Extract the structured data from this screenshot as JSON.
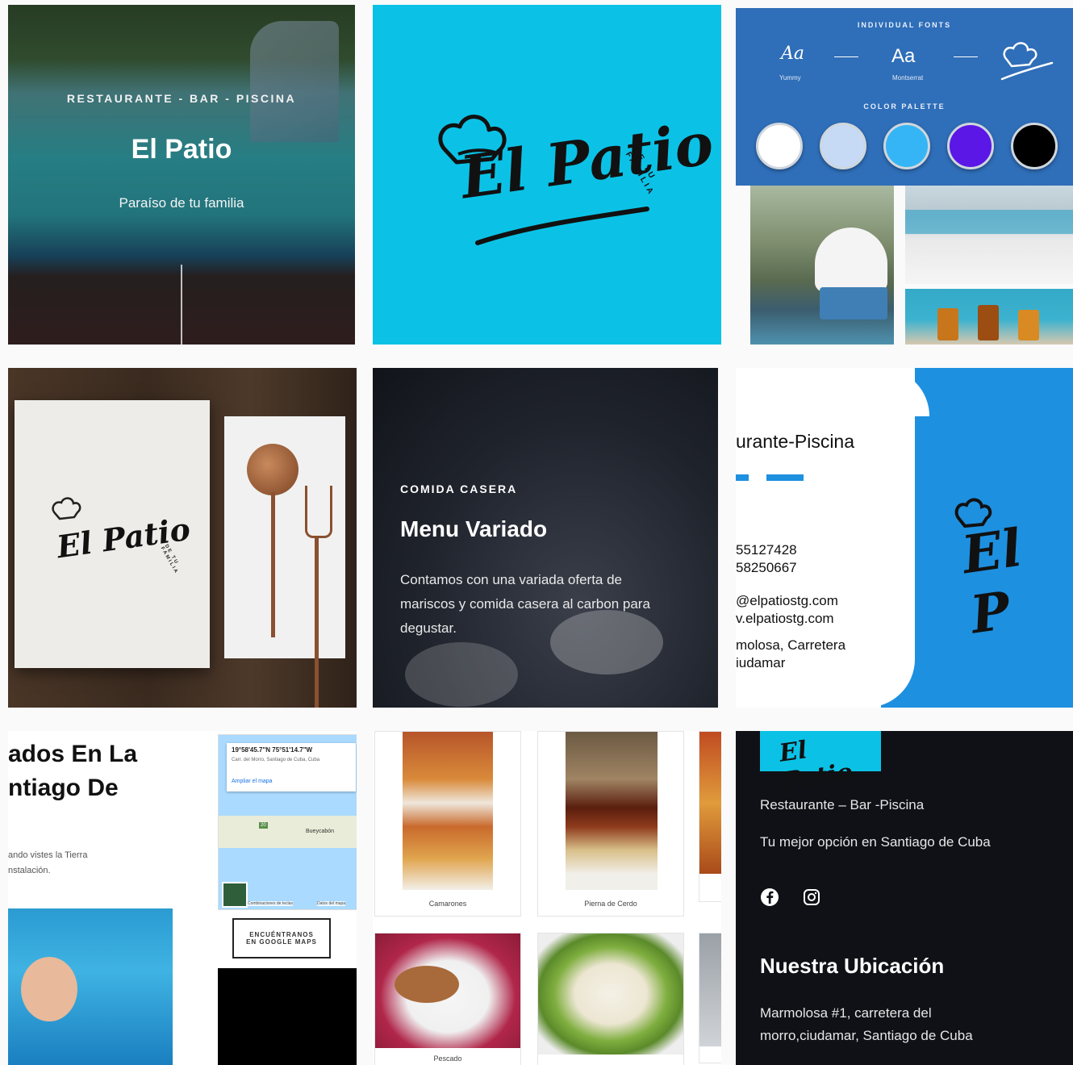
{
  "tile1": {
    "tagline": "RESTAURANTE - BAR - PISCINA",
    "title": "El Patio",
    "subtitle": "Paraíso de tu familia"
  },
  "logo": {
    "main": "El Patio",
    "arc": "DE TU FAMILIA"
  },
  "brand": {
    "fonts_heading": "INDIVIDUAL FONTS",
    "font1_sample": "Aa",
    "font1_name": "Yummy",
    "font2_sample": "Aa",
    "font2_name": "Montserrat",
    "palette_heading": "COLOR PALETTE",
    "palette": [
      "#ffffff",
      "#c6d9f5",
      "#35b5f5",
      "#5a17e6",
      "#000000"
    ]
  },
  "menu_tile": {
    "eyebrow": "COMIDA CASERA",
    "title": "Menu Variado",
    "body": "Contamos con una variada oferta de mariscos y comida casera al carbon para degustar."
  },
  "card": {
    "heading": "urante-Piscina",
    "phone1": "55127428",
    "phone2": "58250667",
    "email": "@elpatiostg.com",
    "web": "v.elpatiostg.com",
    "addr1": "molosa, Carretera",
    "addr2": "iudamar",
    "logo": "El P"
  },
  "location": {
    "heading_line1": "ados En La",
    "heading_line2": "ntiago De",
    "body_line1": "ando vistes la Tierra",
    "body_line2": "nstalación.",
    "map_coords": "19°58'45.7\"N 75°51'14.7\"W",
    "map_address": "Carr. del Morro, Santiago de Cuba, Cuba",
    "map_link": "Ampliar el mapa",
    "map_place": "Bueycabón",
    "map_road": "20",
    "map_footer_a": "Combinaciones de teclas",
    "map_footer_b": "Datos del mapa",
    "button": "ENCUÉNTRANOS EN GOOGLE MAPS"
  },
  "dishes": [
    {
      "name": "Camarones"
    },
    {
      "name": "Pierna de Cerdo"
    },
    {
      "name": "Pescado"
    }
  ],
  "footer": {
    "logo": "El Patio",
    "line1": "Restaurante – Bar -Piscina",
    "line2": "Tu mejor opción en Santiago de Cuba",
    "heading": "Nuestra Ubicación",
    "addr1": "Marmolosa #1, carretera del",
    "addr2": "morro,ciudamar, Santiago de Cuba"
  },
  "colors": {
    "cyan": "#0bc2e6",
    "brand_blue": "#2f6eb8",
    "card_blue": "#1e90e0",
    "dark": "#0f1116"
  }
}
